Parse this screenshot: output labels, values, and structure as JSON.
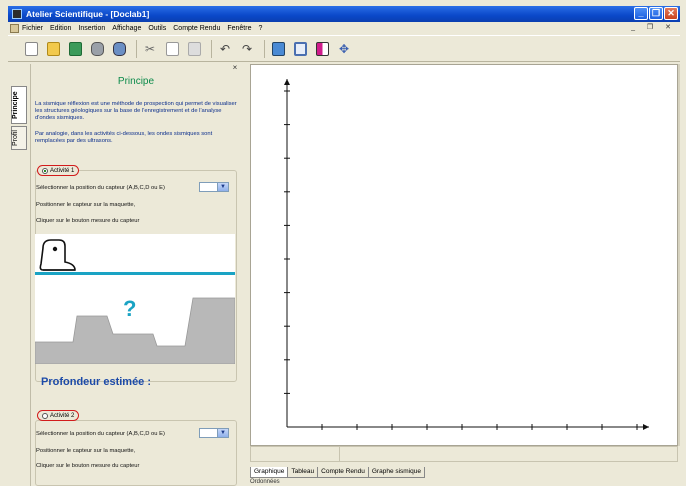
{
  "window": {
    "title": "Atelier Scientifique - [Doclab1]"
  },
  "menu": [
    "Fichier",
    "Edition",
    "Insertion",
    "Affichage",
    "Outils",
    "Compte Rendu",
    "Fenêtre",
    "?"
  ],
  "side_tabs": [
    "Principe",
    "Profil"
  ],
  "panel": {
    "title": "Principe",
    "intro": "La sismique réflexion est une méthode de prospection qui permet de visualiser les structures géologiques sur la base de l'enregistrement et de l'analyse d'ondes sismiques.",
    "analogy": "Par analogie, dans les activités ci-dessous, les ondes sismiques sont remplacées par des ultrasons.",
    "activity1": {
      "label": "Activité 1",
      "select_prompt": "Sélectionner la position du capteur (A,B,C,D ou E)",
      "step2": "Positionner le capteur sur la maquette,",
      "step3": "Cliquer sur le bouton mesure du capteur"
    },
    "question_mark": "?",
    "estimate_label": "Profondeur estimée :",
    "activity2": {
      "label": "Activité 2",
      "select_prompt": "Sélectionner la position du capteur (A,B,C,D ou E)",
      "step2": "Positionner le capteur sur la maquette,",
      "step3": "Cliquer sur le bouton mesure du capteur"
    }
  },
  "bottom_tabs": [
    "Graphique",
    "Tableau",
    "Compte Rendu",
    "Graphe sismique"
  ],
  "status": "Ordonnées",
  "colors": {
    "title_green": "#0b8a4a",
    "text_blue": "#0b2e8c",
    "accent_red": "#d21c1c",
    "water_line": "#1aa3c4"
  }
}
